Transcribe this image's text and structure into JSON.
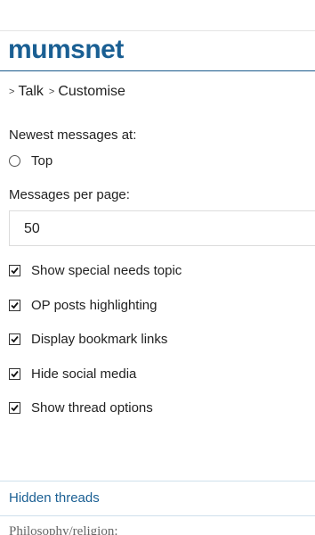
{
  "brand": {
    "logo_text": "mumsnet"
  },
  "breadcrumb": [
    {
      "sep": ">",
      "label": "Talk"
    },
    {
      "sep": ">",
      "label": "Customise"
    }
  ],
  "newest_messages": {
    "label": "Newest messages at:",
    "options": [
      {
        "label": "Top",
        "selected": false
      }
    ]
  },
  "messages_per_page": {
    "label": "Messages per page:",
    "value": "50"
  },
  "options": [
    {
      "label": "Show special needs topic",
      "checked": true
    },
    {
      "label": "OP posts highlighting",
      "checked": true
    },
    {
      "label": "Display bookmark links",
      "checked": true
    },
    {
      "label": "Hide social media",
      "checked": true
    },
    {
      "label": "Show thread options",
      "checked": true
    }
  ],
  "hidden_threads": {
    "label": "Hidden threads"
  },
  "philosophy": {
    "label": "Philosophy/religion:"
  },
  "colors": {
    "brand": "#1a5f93",
    "link": "#1a5f93"
  }
}
